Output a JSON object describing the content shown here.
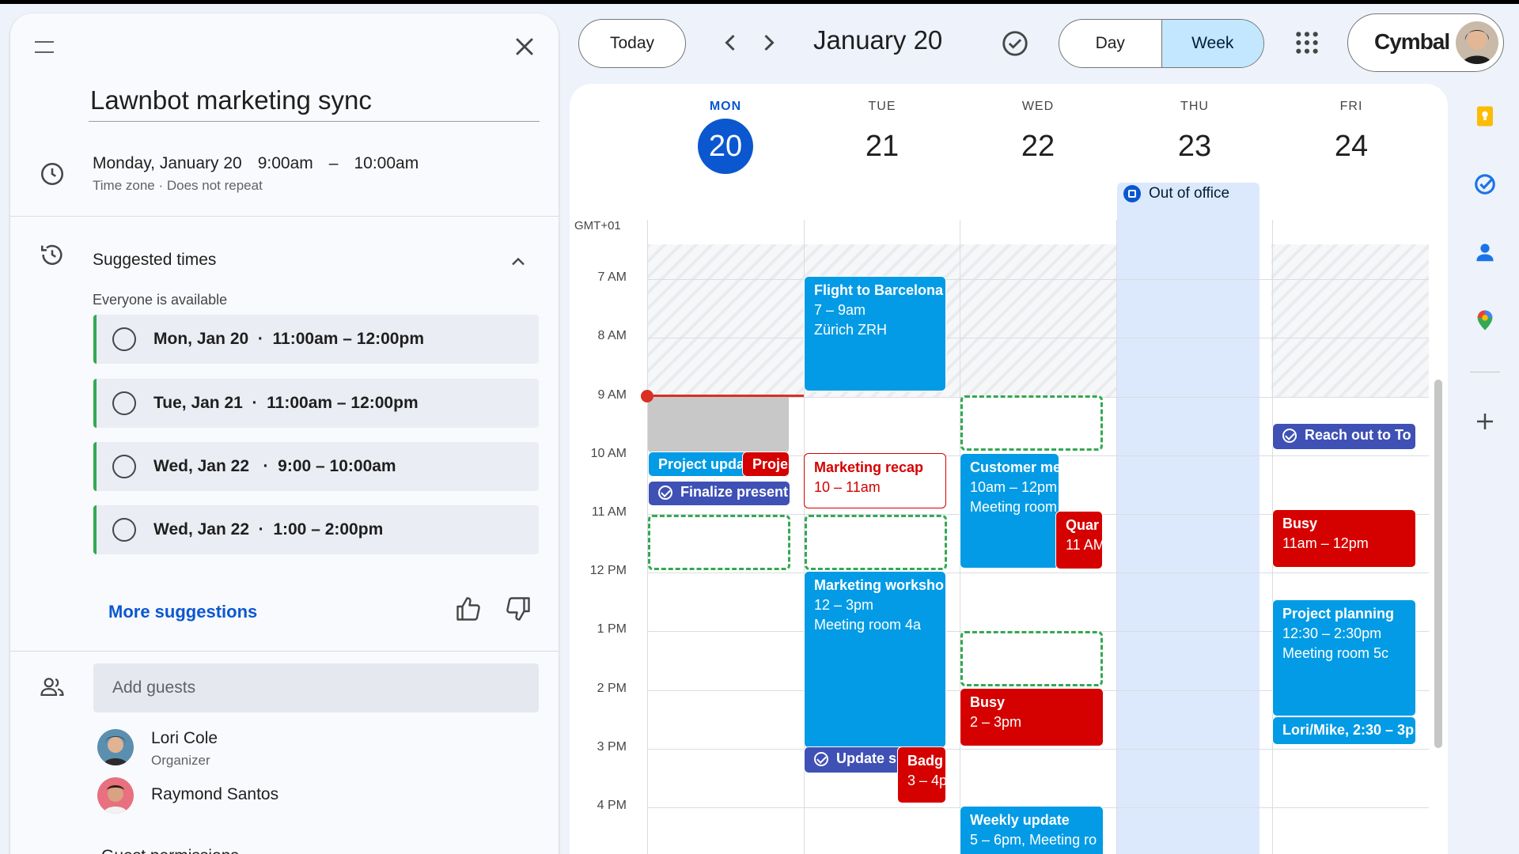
{
  "event": {
    "title": "Lawnbot marketing sync",
    "date": "Monday, January 20",
    "start": "9:00am",
    "dash": "–",
    "end": "10:00am",
    "subline": "Time zone · Does not repeat"
  },
  "suggested": {
    "title": "Suggested times",
    "availability": "Everyone is available",
    "slots": [
      {
        "label": "Mon, Jan 20  ·  11:00am – 12:00pm"
      },
      {
        "label": "Tue, Jan 21  ·  11:00am – 12:00pm"
      },
      {
        "label": "Wed, Jan 22   ·  9:00 – 10:00am"
      },
      {
        "label": "Wed, Jan 22  ·  1:00 – 2:00pm"
      }
    ],
    "more": "More suggestions"
  },
  "guests": {
    "placeholder": "Add guests",
    "list": [
      {
        "name": "Lori Cole",
        "role": "Organizer"
      },
      {
        "name": "Raymond Santos",
        "role": ""
      }
    ],
    "permissions": "Guest permissions"
  },
  "toolbar": {
    "today": "Today",
    "current_date": "January 20",
    "view_day": "Day",
    "view_week": "Week",
    "brand": "Cymbal"
  },
  "calendar": {
    "timezone": "GMT+01",
    "days": [
      {
        "dow": "MON",
        "num": "20"
      },
      {
        "dow": "TUE",
        "num": "21"
      },
      {
        "dow": "WED",
        "num": "22"
      },
      {
        "dow": "THU",
        "num": "23"
      },
      {
        "dow": "FRI",
        "num": "24"
      }
    ],
    "hours": [
      "7 AM",
      "8 AM",
      "9 AM",
      "10 AM",
      "11 AM",
      "12 PM",
      "1 PM",
      "2 PM",
      "3 PM",
      "4 PM"
    ],
    "out_of_office": "Out of office",
    "events": {
      "flight": {
        "title": "Flight to Barcelona",
        "time": "7 – 9am",
        "place": "Zürich ZRH"
      },
      "project_update": {
        "title": "Project upda"
      },
      "proje": {
        "title": "Proje"
      },
      "finalize": {
        "title": "Finalize present"
      },
      "marketing_recap": {
        "title": "Marketing recap",
        "time": "10 – 11am"
      },
      "marketing_workshop": {
        "title": "Marketing worksho",
        "time": "12 – 3pm",
        "place": "Meeting room 4a"
      },
      "update_s": {
        "title": "Update s"
      },
      "badg": {
        "title": "Badg",
        "time": "3 – 4p"
      },
      "customer": {
        "title": "Customer me",
        "time": "10am – 12pm",
        "place": "Meeting room"
      },
      "quar": {
        "title": "Quar",
        "time": "11 AM"
      },
      "busy_wed": {
        "title": "Busy",
        "time": "2 – 3pm"
      },
      "weekly": {
        "title": "Weekly update",
        "time": "5 – 6pm, Meeting ro"
      },
      "reach_out": {
        "title": "Reach out to To"
      },
      "busy_fri": {
        "title": "Busy",
        "time": "11am – 12pm"
      },
      "project_planning": {
        "title": "Project planning",
        "time": "12:30 – 2:30pm",
        "place": "Meeting room 5c"
      },
      "lori_mike": {
        "title": "Lori/Mike, 2:30 – 3p"
      }
    }
  },
  "colors": {
    "accent": "#0b57d0",
    "event_blue": "#039be5",
    "event_red": "#d50000",
    "task": "#3f51b5",
    "suggest": "#34a853"
  },
  "icons": [
    "menu-icon",
    "close-icon",
    "clock-icon",
    "history-icon",
    "chevron-up-icon",
    "thumb-up-icon",
    "thumb-down-icon",
    "people-icon",
    "chevron-left-icon",
    "chevron-right-icon",
    "task-check-icon",
    "apps-grid-icon",
    "keep-icon",
    "tasks-icon",
    "contacts-icon",
    "maps-icon",
    "add-icon"
  ]
}
